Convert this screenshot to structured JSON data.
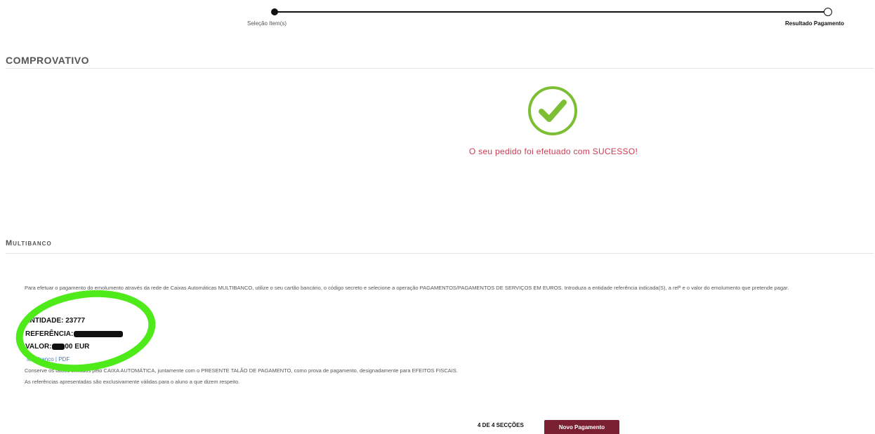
{
  "stepper": {
    "steps": [
      {
        "label": "Seleção Item(s)",
        "state": "done"
      },
      {
        "label": "Resultado Pagamento",
        "state": "current"
      }
    ]
  },
  "comprovativo": {
    "title": "COMPROVATIVO",
    "success_icon": "check-circle-icon",
    "success_color": "#7cbf35",
    "success_message": "O seu pedido foi efetuado com SUCESSO!",
    "message_color": "#cc3b52"
  },
  "multibanco": {
    "title": "Multibanco",
    "intro": "Para efetuar o pagamento do emolumento através da rede de Caixas Automáticas MULTIBANCO, utilize o seu cartão bancário, o código secreto e selecione a operação PAGAMENTOS/PAGAMENTOS DE SERVIÇOS EM EUROS. Introduza a entidade referência indicada(S), a refª e o valor do emolumento que pretende pagar.",
    "entidade_label": "ENTIDADE: 23777",
    "referencia_label": "REFERÊNCIA:",
    "valor_label": "VALOR:",
    "valor_suffix": ".00 EUR",
    "link_text": "Multibanco",
    "link_sep": " | ",
    "pdf_text": "PDF",
    "conserve_text": "Conserve os talões emitidos pelo CAIXA AUTOMÁTICA, juntamente com o PRESENTE TALÃO DE PAGAMENTO, como prova de pagamento, designadamente para EFEITOS FISCAIS.",
    "note_text": "As referências apresentadas são exclusivamente válidas para o aluno a que dizem respeito.",
    "highlight_color": "#4fea1a"
  },
  "footer": {
    "progress": "4 DE 4 SECÇÕES",
    "novo_button": "Novo Pagamento",
    "button_color": "#7b1f33"
  }
}
